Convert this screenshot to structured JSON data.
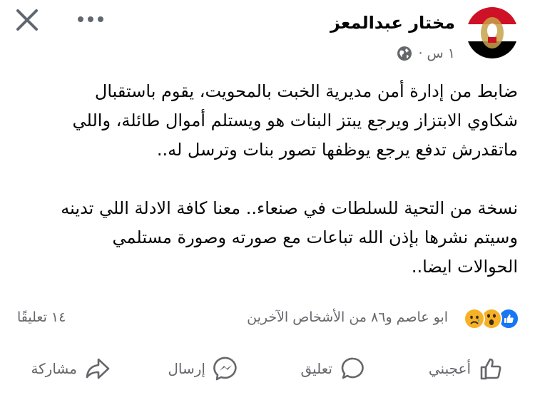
{
  "header": {
    "author_name": "مختار عبدالمعز",
    "time": "١ س ·",
    "close_icon": "close-icon",
    "more_icon": "more-horizontal-icon",
    "privacy_icon": "globe-icon"
  },
  "post": {
    "paragraph1": [
      "ضابط من إدارة أمن مديرية الخبت بالمحويت، يقوم باستقبال",
      "شكاوي الابتزاز ويرجع يبتز البنات هو ويستلم أموال طائلة، واللي",
      "ماتقدرش تدفع يرجع يوظفها تصور بنات وترسل له.."
    ],
    "paragraph2": [
      "نسخة من التحية للسلطات في صنعاء.. معنا كافة الادلة اللي تدينه",
      "وسيتم نشرها بإذن الله تباعات مع صورته وصورة مستلمي",
      "الحوالات ايضا.."
    ]
  },
  "stats": {
    "reactors": "ابو عاصم و٨٦ من الأشخاص الآخرين",
    "comments": "١٤ تعليقًا",
    "reaction_icons": [
      "like-icon",
      "wow-icon",
      "sad-icon"
    ]
  },
  "actions": {
    "like": "أعجبني",
    "comment": "تعليق",
    "send": "إرسال",
    "share": "مشاركة"
  },
  "colors": {
    "like_blue": "#1877f2",
    "reaction_yellow": "#f7b125",
    "secondary_text": "#65676b"
  }
}
